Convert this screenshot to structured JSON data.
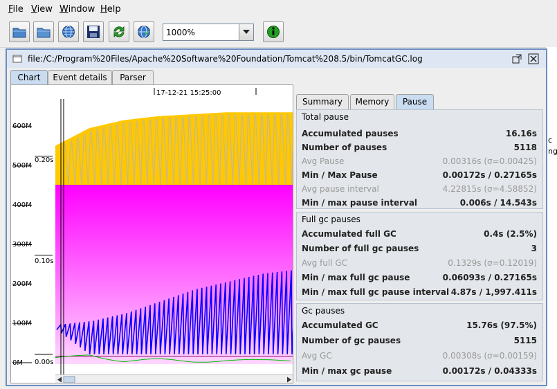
{
  "menu": {
    "file_prefix": "F",
    "file_rest": "ile",
    "view_prefix": "V",
    "view_rest": "iew",
    "window_prefix": "W",
    "window_rest": "indow",
    "help_prefix": "H",
    "help_rest": "elp"
  },
  "toolbar": {
    "zoom_value": "1000%",
    "icons": [
      "open-folder-icon",
      "open-folder-icon",
      "globe-icon",
      "save-icon",
      "refresh-icon",
      "globe-refresh-icon",
      "info-icon"
    ]
  },
  "desktop_strip": {
    "line1": "c",
    "line2": "ng"
  },
  "document": {
    "title": "file:/C:/Program%20Files/Apache%20Software%20Foundation/Tomcat%208.5/bin/TomcatGC.log",
    "tabs": [
      "Chart",
      "Event details",
      "Parser"
    ],
    "active_tab": "Chart"
  },
  "chart": {
    "timestamp_label": "17-12-21 15:25:00",
    "memory_ticks": [
      "600M",
      "500M",
      "400M",
      "300M",
      "200M",
      "100M",
      "0M"
    ],
    "pause_ticks": [
      "0.20s",
      "0.10s",
      "0.00s"
    ],
    "colors": {
      "heap": "#ffc800",
      "tenured": "#ff00ff",
      "used": "#0000ff",
      "pause": "#00c000",
      "background": "#ffffff"
    }
  },
  "chart_data": {
    "type": "area",
    "title": "",
    "x_markers": [
      "17-12-21 15:25:00"
    ],
    "y_axes": [
      {
        "ticks": [
          "0M",
          "100M",
          "200M",
          "300M",
          "400M",
          "500M",
          "600M"
        ],
        "range_mb": [
          0,
          630
        ]
      },
      {
        "ticks": [
          "0.00s",
          "0.10s",
          "0.20s"
        ],
        "range_s": [
          0,
          0.25
        ]
      }
    ],
    "series": [
      {
        "color": "#ffc800",
        "values_mb": [
          555,
          600,
          620,
          630,
          635,
          640,
          640,
          640
        ]
      },
      {
        "color": "#ff00ff",
        "values_mb": [
          455,
          455,
          455,
          455,
          455,
          455,
          455,
          455
        ]
      },
      {
        "color": "#0000ff",
        "min_mb": [
          90,
          25,
          25,
          25,
          25,
          25,
          25,
          25
        ],
        "max_mb": [
          100,
          110,
          130,
          160,
          190,
          210,
          230,
          240
        ]
      },
      {
        "color": "#00c000",
        "values_s": [
          0.005,
          0.01,
          0.003,
          0.004,
          0.003,
          0.004,
          0.003,
          0.004
        ]
      }
    ]
  },
  "right_tabs": [
    "Summary",
    "Memory",
    "Pause"
  ],
  "active_right_tab": "Pause",
  "pause": {
    "total": {
      "title": "Total pause",
      "rows": [
        {
          "label": "Accumulated pauses",
          "value": "16.16s",
          "style": "bold"
        },
        {
          "label": "Number of pauses",
          "value": "5118",
          "style": "bold"
        },
        {
          "label": "Avg Pause",
          "value": "0.00316s (σ=0.00425)",
          "style": "dim"
        },
        {
          "label": "Min / Max Pause",
          "value": "0.00172s / 0.27165s",
          "style": "bold"
        },
        {
          "label": "Avg pause interval",
          "value": "4.22815s (σ=4.58852)",
          "style": "dim"
        },
        {
          "label": "Min / max pause interval",
          "value": "0.006s / 14.543s",
          "style": "bold"
        }
      ]
    },
    "full_gc": {
      "title": "Full gc pauses",
      "rows": [
        {
          "label": "Accumulated full GC",
          "value": "0.4s (2.5%)",
          "style": "bold"
        },
        {
          "label": "Number of full gc pauses",
          "value": "3",
          "style": "bold"
        },
        {
          "label": "Avg full GC",
          "value": "0.1329s (σ=0.12019)",
          "style": "dim"
        },
        {
          "label": "Min / max full gc pause",
          "value": "0.06093s / 0.27165s",
          "style": "bold"
        },
        {
          "label": "Min / max full gc pause interval",
          "value": "4.87s / 1,997.411s",
          "style": "bold"
        }
      ]
    },
    "gc": {
      "title": "Gc pauses",
      "rows": [
        {
          "label": "Accumulated GC",
          "value": "15.76s (97.5%)",
          "style": "bold"
        },
        {
          "label": "Number of gc pauses",
          "value": "5115",
          "style": "bold"
        },
        {
          "label": "Avg GC",
          "value": "0.00308s (σ=0.00159)",
          "style": "dim"
        },
        {
          "label": "Min / max gc pause",
          "value": "0.00172s / 0.04333s",
          "style": "bold"
        }
      ]
    }
  }
}
